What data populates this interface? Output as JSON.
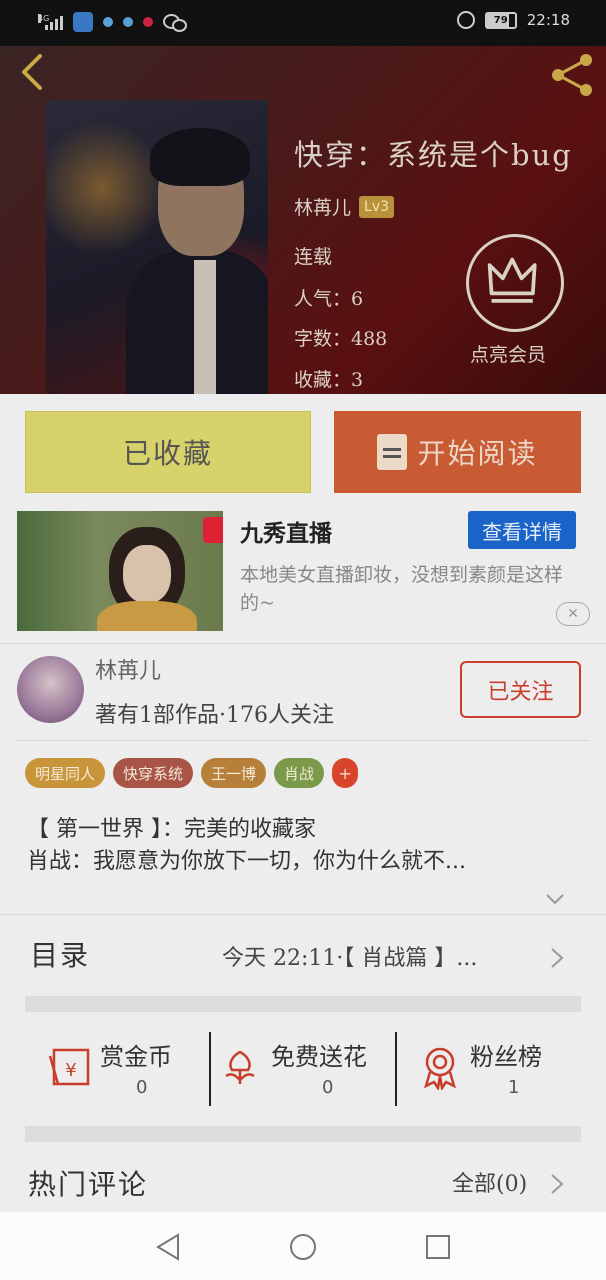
{
  "status_bar": {
    "network": "4G",
    "battery": "79",
    "time": "22:18"
  },
  "book": {
    "title": "快穿：系统是个bug",
    "author": "林苒儿",
    "level": "Lv3",
    "status": "连载",
    "popularity": "人气：6",
    "word_count": "字数：488",
    "favorites": "收藏：3",
    "vip_label": "点亮会员"
  },
  "actions": {
    "favorited_label": "已收藏",
    "read_label": "开始阅读"
  },
  "ad": {
    "title": "九秀直播",
    "detail_label": "查看详情",
    "description": "本地美女直播卸妆，没想到素颜是这样的~",
    "close": "✕"
  },
  "author_card": {
    "name": "林苒儿",
    "stats": "著有1部作品·176人关注",
    "follow_label": "已关注"
  },
  "tags": [
    {
      "label": "明星同人",
      "color": "#c9953a"
    },
    {
      "label": "快穿系统",
      "color": "#a85446"
    },
    {
      "label": "王一博",
      "color": "#b6803a"
    },
    {
      "label": "肖战",
      "color": "#7a9a4a"
    }
  ],
  "tag_more": "+",
  "synopsis": {
    "line1": "【 第一世界 】：完美的收藏家",
    "line2": "肖战：我愿意为你放下一切，你为什么就不..."
  },
  "toc": {
    "label": "目录",
    "latest": "今天 22:11·【 肖战篇 】..."
  },
  "stats": [
    {
      "label": "赏金币",
      "value": "0",
      "icon": "red-envelope-icon"
    },
    {
      "label": "免费送花",
      "value": "0",
      "icon": "flower-icon"
    },
    {
      "label": "粉丝榜",
      "value": "1",
      "icon": "ribbon-badge-icon"
    }
  ],
  "comments": {
    "label": "热门评论",
    "all_label": "全部(0)"
  },
  "colors": {
    "accent_red": "#c83d2c",
    "read_button": "#c85a34",
    "favorite_button": "#d8d26a",
    "ad_button": "#1a63c7"
  }
}
